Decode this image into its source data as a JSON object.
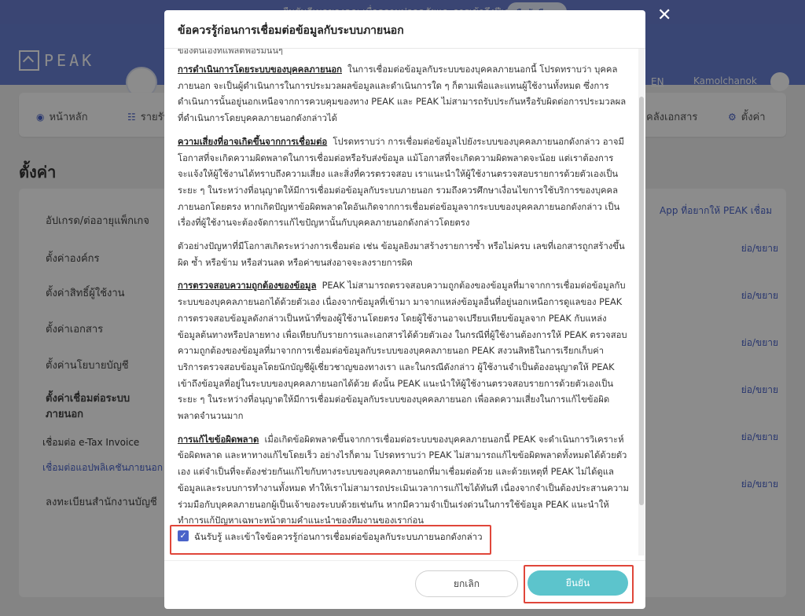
{
  "top_banner": {
    "promo_text": "ยืนยันอีเมลของคุณ เพื่อความปลอดภัยและการเข้าถึงฟีเจอร์ที่มากขึ้น",
    "promo_button": "ยืนยันอีเมล"
  },
  "header": {
    "logo_text": "PEAK",
    "lang": "EN",
    "user_name": "Kamolchanok"
  },
  "nav": {
    "home": "หน้าหลัก",
    "income": "รายรับ",
    "docs": "คลังเอกสาร",
    "settings": "ตั้งค่า"
  },
  "page": {
    "title": "ตั้งค่า"
  },
  "sidebar": {
    "items": [
      "อัปเกรด/ต่ออายุแพ็กเกจ",
      "ตั้งค่าองค์กร",
      "ตั้งค่าสิทธิ์ผู้ใช้งาน",
      "ตั้งค่าเอกสาร",
      "ตั้งค่านโยบายบัญชี",
      "ตั้งค่าเชื่อมต่อระบบ",
      "ภายนอก"
    ],
    "sub_items": [
      "เชื่อมต่อ e-Tax Invoice",
      "เชื่อมต่อแอปพลิเคชันภายนอก",
      "ลงทะเบียนสำนักงานบัญชี"
    ]
  },
  "right_links": {
    "app_request": "App ที่อยากให้ PEAK เชื่อม",
    "collapse": "ย่อ/ขยาย"
  },
  "modal": {
    "title": "ข้อควรรู้ก่อนการเชื่อมต่อข้อมูลกับระบบภายนอก",
    "cutoff_text": "ของตนเองที่แพลตฟอร์มนั้นๆ",
    "sections": [
      {
        "heading": "การดำเนินการโดยระบบของบุคคลภายนอก",
        "body": "ในการเชื่อมต่อข้อมูลกับระบบของบุคคลภายนอกนี้ โปรดทราบว่า บุคคลภายนอก จะเป็นผู้ดำเนินการในการประมวลผลข้อมูลและดำเนินการใด ๆ ก็ตามเพื่อและแทนผู้ใช้งานทั้งหมด ซึ่งการดำเนินการนั้นอยู่นอกเหนือจากการควบคุมของทาง PEAK และ PEAK ไม่สามารถรับประกันหรือรับผิดต่อการประมวลผลที่ดำเนินการโดยบุคคลภายนอกดังกล่าวได้"
      },
      {
        "heading": "ความเสี่ยงที่อาจเกิดขึ้นจากการเชื่อมต่อ",
        "body": "โปรดทราบว่า การเชื่อมต่อข้อมูลไปยังระบบของบุคคลภายนอกดังกล่าว อาจมีโอกาสที่จะเกิดความผิดพลาดในการเชื่อมต่อหรือรับส่งข้อมูล แม้โอกาสที่จะเกิดความผิดพลาดจะน้อย แต่เราต้องการจะแจ้งให้ผู้ใช้งานได้ทราบถึงความเสี่ยง และสิ่งที่ควรตรวจสอบ เราแนะนำให้ผู้ใช้งานตรวจสอบรายการด้วยตัวเองเป็นระยะ ๆ ในระหว่างที่อนุญาตให้มีการเชื่อมต่อข้อมูลกับระบบภายนอก รวมถึงควรศึกษาเงื่อนไขการใช้บริการของบุคคลภายนอกโดยตรง หากเกิดปัญหาข้อผิดพลาดใดอันเกิดจากการเชื่อมต่อข้อมูลจากระบบของบุคคลภายนอกดังกล่าว เป็นเรื่องที่ผู้ใช้งานจะต้องจัดการแก้ไขปัญหานั้นกับบุคคลภายนอกดังกล่าวโดยตรง"
      },
      {
        "heading": "",
        "body": "ตัวอย่างปัญหาที่มีโอกาสเกิดระหว่างการเชื่อมต่อ เช่น ข้อมูลยิงมาสร้างรายการซ้ำ หรือไม่ครบ เลขที่เอกสารถูกสร้างขึ้นผิด ซ้ำ หรือข้าม หรือส่วนลด หรือค่าขนส่งอาจจะลงรายการผิด"
      },
      {
        "heading": "การตรวจสอบความถูกต้องของข้อมูล",
        "body": "PEAK ไม่สามารถตรวจสอบความถูกต้องของข้อมูลที่มาจากการเชื่อมต่อข้อมูลกับระบบของบุคคลภายนอกได้ด้วยตัวเอง เนื่องจากข้อมูลที่เข้ามา มาจากแหล่งข้อมูลอื่นที่อยู่นอกเหนือการดูแลของ PEAK การตรวจสอบข้อมูลดังกล่าวเป็นหน้าที่ของผู้ใช้งานโดยตรง โดยผู้ใช้งานอาจเปรียบเทียบข้อมูลจาก PEAK กับแหล่งข้อมูลต้นทางหรือปลายทาง เพื่อเทียบกับรายการและเอกสารได้ด้วยตัวเอง ในกรณีที่ผู้ใช้งานต้องการให้ PEAK ตรวจสอบความถูกต้องของข้อมูลที่มาจากการเชื่อมต่อข้อมูลกับระบบของบุคคลภายนอก PEAK สงวนสิทธิในการเรียกเก็บค่าบริการตรวจสอบข้อมูลโดยนักบัญชีผู้เชี่ยวชาญของทางเรา และในกรณีดังกล่าว ผู้ใช้งานจำเป็นต้องอนุญาตให้ PEAK เข้าถึงข้อมูลที่อยู่ในระบบของบุคคลภายนอกได้ด้วย ดังนั้น PEAK แนะนำให้ผู้ใช้งานตรวจสอบรายการด้วยตัวเองเป็นระยะ ๆ ในระหว่างที่อนุญาตให้มีการเชื่อมต่อข้อมูลกับระบบของบุคคลภายนอก เพื่อลดความเสี่ยงในการแก้ไขข้อผิดพลาดจำนวนมาก"
      },
      {
        "heading": "การแก้ไขข้อผิดพลาด",
        "body": "เมื่อเกิดข้อผิดพลาดขึ้นจากการเชื่อมต่อระบบของบุคคลภายนอกนี้ PEAK จะดำเนินการวิเคราะห์ข้อผิดพลาด และหาทางแก้ไขโดยเร็ว อย่างไรก็ตาม โปรดทราบว่า PEAK ไม่สามารถแก้ไขข้อผิดพลาดทั้งหมดได้ด้วยตัวเอง แต่จำเป็นที่จะต้องช่วยกันแก้ไขกับทางระบบของบุคคลภายนอกที่มาเชื่อมต่อด้วย และด้วยเหตุที่ PEAK ไม่ได้ดูแลข้อมูลและระบบการทำงานทั้งหมด ทำให้เราไม่สามารถประเมินเวลาการแก้ไขได้ทันที เนื่องจากจำเป็นต้องประสานความร่วมมือกับบุคคลภายนอกผู้เป็นเจ้าของระบบด้วยเช่นกัน หากมีความจำเป็นเร่งด่วนในการใช้ข้อมูล PEAK แนะนำให้ทำการแก้ปัญหาเฉพาะหน้าตามคำแนะนำของทีมงานของเราก่อน"
      }
    ],
    "agree_label": "ฉันรับรู้ และเข้าใจข้อควรรู้ก่อนการเชื่อมต่อข้อมูลกับระบบภายนอกดังกล่าว",
    "cancel": "ยกเลิก",
    "confirm": "ยืนยัน"
  },
  "colors": {
    "primary": "#6880d4",
    "accent": "#4a63c9",
    "confirm": "#5cc4cc",
    "highlight": "#e0463a"
  }
}
